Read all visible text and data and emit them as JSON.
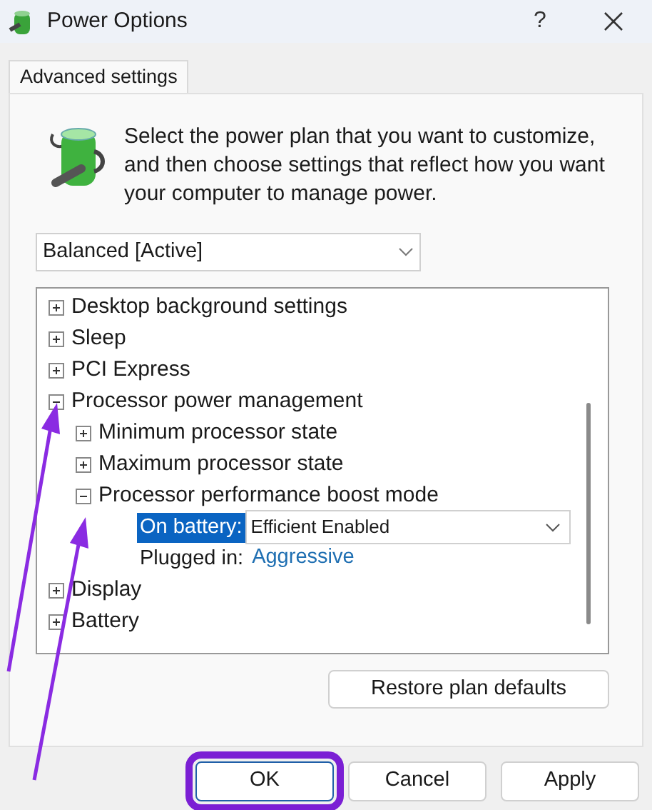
{
  "window": {
    "title": "Power Options",
    "help": "?"
  },
  "tabs": [
    {
      "label": "Advanced settings",
      "selected": true
    }
  ],
  "intro": "Select the power plan that you want to customize, and then choose settings that reflect how you want your computer to manage power.",
  "plan_dropdown": {
    "value": "Balanced [Active]"
  },
  "tree": [
    {
      "label": "Desktop background settings",
      "expanded": false
    },
    {
      "label": "Sleep",
      "expanded": false
    },
    {
      "label": "PCI Express",
      "expanded": false
    },
    {
      "label": "Processor power management",
      "expanded": true,
      "children": [
        {
          "label": "Minimum processor state",
          "expanded": false
        },
        {
          "label": "Maximum processor state",
          "expanded": false
        },
        {
          "label": "Processor performance boost mode",
          "expanded": true,
          "settings": [
            {
              "kind": "dropdown",
              "label": "On battery:",
              "value": "Efficient Enabled",
              "selected": true
            },
            {
              "kind": "link",
              "label": "Plugged in:",
              "value": "Aggressive",
              "selected": false
            }
          ]
        }
      ]
    },
    {
      "label": "Display",
      "expanded": false
    },
    {
      "label": "Battery",
      "expanded": false
    }
  ],
  "restore_button": "Restore plan defaults",
  "buttons": [
    {
      "label": "OK",
      "highlighted": true
    },
    {
      "label": "Cancel",
      "highlighted": false
    },
    {
      "label": "Apply",
      "highlighted": false
    }
  ]
}
